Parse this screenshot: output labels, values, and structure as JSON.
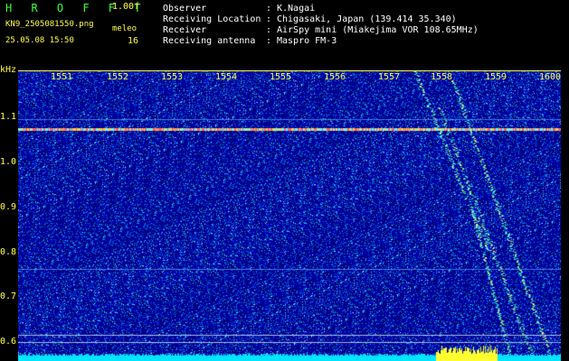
{
  "header": {
    "brand": "H R O F F T",
    "version": "1.00f",
    "filename": "KN9_2505081550.png",
    "meleo_label": "meleo",
    "datetime": "25.05.08 15:50",
    "count": "16"
  },
  "meta": [
    {
      "key": "Observer",
      "value": "K.Nagai"
    },
    {
      "key": "Receiving Location",
      "value": "Chigasaki, Japan (139.414 35.340)"
    },
    {
      "key": "Receiver",
      "value": "AirSpy mini (Miakejima VOR 108.65MHz)"
    },
    {
      "key": "Receiving antenna",
      "value": "Maspro FM-3"
    }
  ],
  "axis": {
    "y_unit": "kHz",
    "x_ticks": [
      "1551",
      "1552",
      "1553",
      "1554",
      "1555",
      "1556",
      "1557",
      "1558",
      "1559",
      "1600"
    ],
    "y_ticks": [
      "1.1",
      "1.0",
      "0.9",
      "0.8",
      "0.7",
      "0.6"
    ]
  },
  "colors": {
    "label": "#ffff40",
    "brand": "#3cff3c",
    "background": "#00007a",
    "carrier": "#ff7070",
    "baseline": "#00e5ff"
  }
}
